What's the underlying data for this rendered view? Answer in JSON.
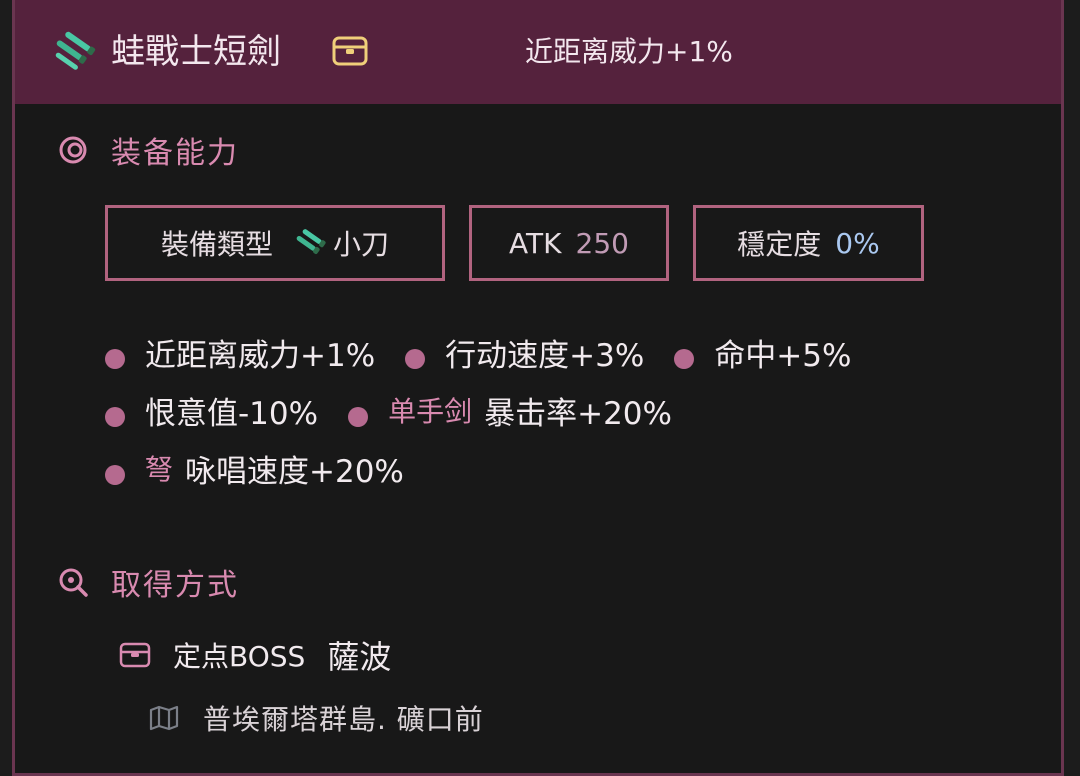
{
  "header": {
    "item_name": "蛙戰士短劍",
    "item_icon": "green-dagger-icon",
    "chest_icon": "chest-icon",
    "main_stat": "近距离威力+1%"
  },
  "equip_section": {
    "title": "装备能力",
    "icon": "circle-icon",
    "type_box": {
      "label": "裝備類型",
      "icon": "dagger-icon",
      "value": "小刀"
    },
    "atk_box": {
      "label": "ATK",
      "value": "250"
    },
    "stability_box": {
      "label": "穩定度",
      "value": "0%"
    },
    "stats_row1": [
      {
        "text": "近距离威力+1%"
      },
      {
        "text": "行动速度+3%"
      },
      {
        "text": "命中+5%"
      }
    ],
    "stats_row2": [
      {
        "text": "恨意值-10%"
      },
      {
        "condition": "单手剑",
        "text": "暴击率+20%"
      }
    ],
    "stats_row3": [
      {
        "condition": "弩",
        "text": "咏唱速度+20%"
      }
    ]
  },
  "source_section": {
    "title": "取得方式",
    "icon": "search-icon",
    "source": {
      "icon": "chest-icon",
      "type": "定点BOSS",
      "name": "薩波"
    },
    "location": {
      "icon": "map-icon",
      "text": "普埃爾塔群島. 礦口前"
    }
  },
  "colors": {
    "header_bg": "#55223d",
    "accent_pink": "#d98ab0",
    "box_border": "#b1637f",
    "dot": "#b56a8f",
    "panel_bg": "#181818"
  }
}
